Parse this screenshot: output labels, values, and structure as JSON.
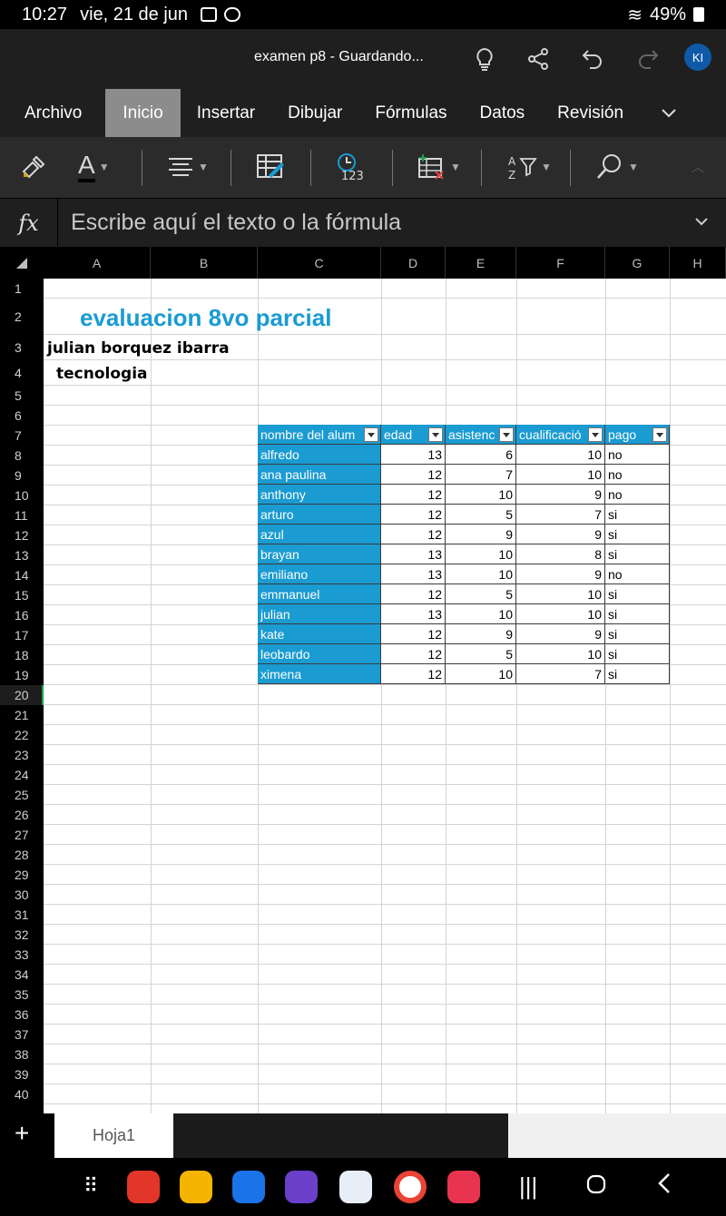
{
  "status": {
    "time": "10:27",
    "date": "vie, 21 de jun",
    "battery": "49%"
  },
  "titlebar": {
    "document": "examen p8 - Guardando...",
    "avatar": "KI"
  },
  "tabs": [
    "Archivo",
    "Inicio",
    "Insertar",
    "Dibujar",
    "Fórmulas",
    "Datos",
    "Revisión"
  ],
  "formula": {
    "placeholder": "Escribe aquí el texto o la fórmula",
    "fx": "fx"
  },
  "columns": [
    "A",
    "B",
    "C",
    "D",
    "E",
    "F",
    "G",
    "H"
  ],
  "rows": [
    "1",
    "2",
    "3",
    "4",
    "5",
    "6",
    "7",
    "8",
    "9",
    "10",
    "11",
    "12",
    "13",
    "14",
    "15",
    "16",
    "17",
    "18",
    "19",
    "20",
    "21",
    "22",
    "23",
    "24",
    "25",
    "26",
    "27",
    "28",
    "29",
    "30",
    "31",
    "32",
    "33",
    "34",
    "35",
    "36",
    "37",
    "38",
    "39",
    "40"
  ],
  "sheet": {
    "title": "evaluacion 8vo parcial",
    "student": "julian borquez ibarra",
    "subject": "tecnologia",
    "table": {
      "headers": [
        "nombre del alum",
        "edad",
        "asistenc",
        "cualificació",
        "pago"
      ],
      "rows": [
        [
          "alfredo",
          "13",
          "6",
          "10",
          "no"
        ],
        [
          "ana paulina",
          "12",
          "7",
          "10",
          "no"
        ],
        [
          "anthony",
          "12",
          "10",
          "9",
          "no"
        ],
        [
          "arturo",
          "12",
          "5",
          "7",
          "si"
        ],
        [
          "azul",
          "12",
          "9",
          "9",
          "si"
        ],
        [
          "brayan",
          "13",
          "10",
          "8",
          "si"
        ],
        [
          "emiliano",
          "13",
          "10",
          "9",
          "no"
        ],
        [
          "emmanuel",
          "12",
          "5",
          "10",
          "si"
        ],
        [
          "julian",
          "13",
          "10",
          "10",
          "si"
        ],
        [
          "kate",
          "12",
          "9",
          "9",
          "si"
        ],
        [
          "leobardo",
          "12",
          "5",
          "10",
          "si"
        ],
        [
          "ximena",
          "12",
          "10",
          "7",
          "si"
        ]
      ]
    }
  },
  "sheettabs": {
    "active": "Hoja1",
    "add": "+"
  },
  "colors": {
    "accent": "#1a9bd2",
    "active_tab": "#8c8c8c",
    "avatar": "#0f5aa8"
  }
}
